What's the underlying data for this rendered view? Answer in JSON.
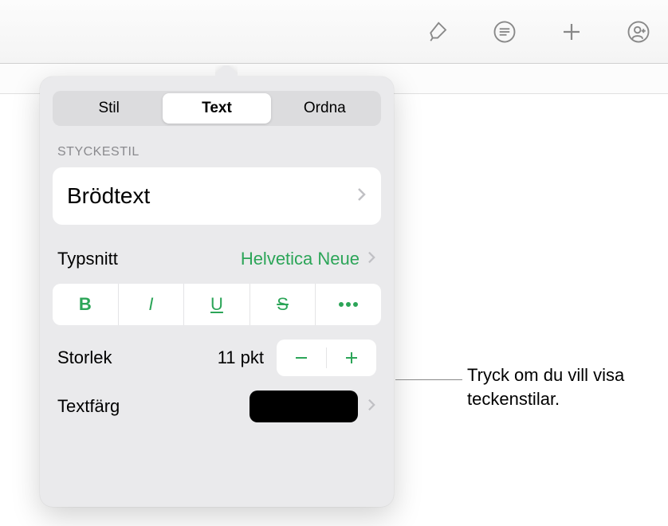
{
  "tabs": {
    "style": "Stil",
    "text": "Text",
    "arrange": "Ordna"
  },
  "paragraphStyle": {
    "heading": "STYCKESTIL",
    "current": "Brödtext"
  },
  "font": {
    "label": "Typsnitt",
    "value": "Helvetica Neue"
  },
  "formatButtons": {
    "bold": "B",
    "italic": "I",
    "underline": "U",
    "strikethrough": "S",
    "more": "more"
  },
  "size": {
    "label": "Storlek",
    "value": "11 pkt"
  },
  "textColor": {
    "label": "Textfärg",
    "value": "#000000"
  },
  "callout": {
    "text": "Tryck om du vill visa teckenstilar."
  },
  "icons": {
    "brush": "brush",
    "list": "list",
    "plus": "plus",
    "collaborate": "collaborate"
  },
  "colors": {
    "accent": "#2ca558"
  }
}
